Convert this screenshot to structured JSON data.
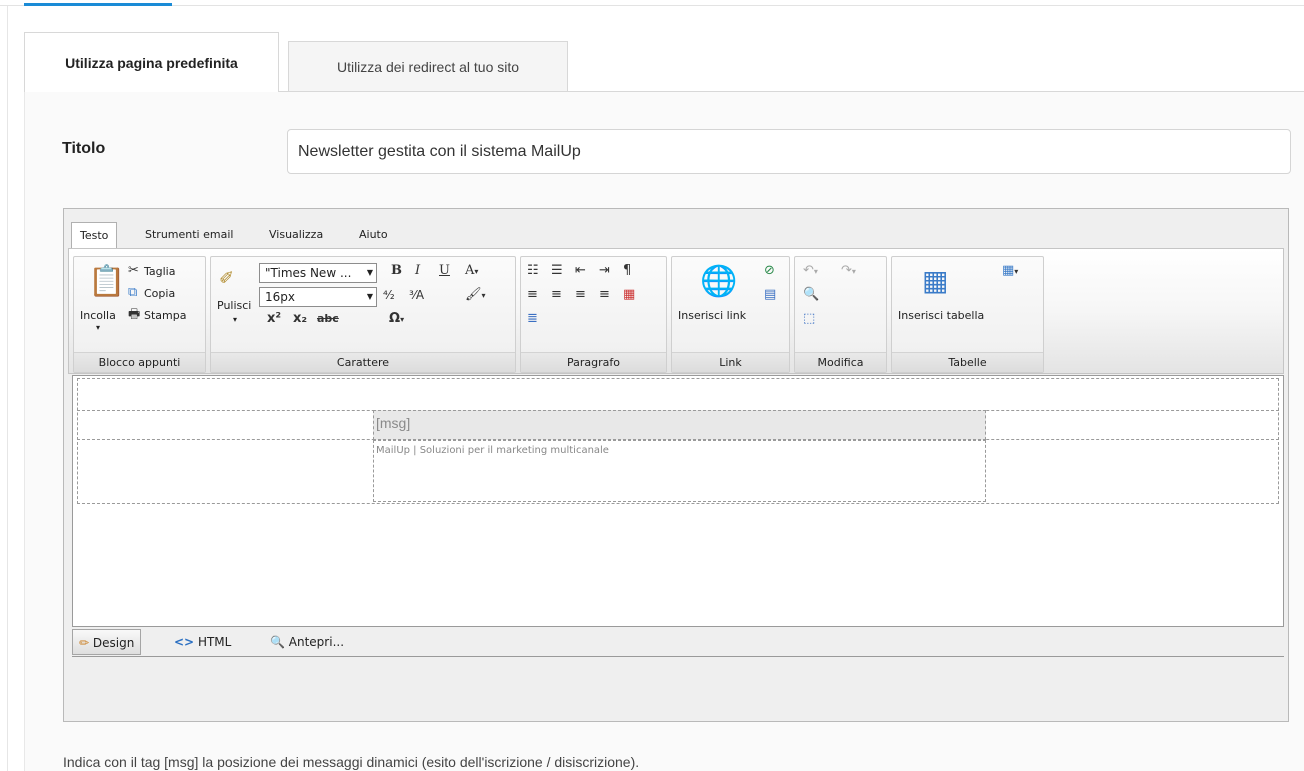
{
  "tabs": {
    "default_page": "Utilizza pagina predefinita",
    "redirect": "Utilizza dei redirect al tuo sito"
  },
  "form": {
    "title_label": "Titolo",
    "title_value": "Newsletter gestita con il sistema MailUp"
  },
  "editor": {
    "ribbon_tabs": [
      "Testo",
      "Strumenti email",
      "Visualizza",
      "Aiuto"
    ],
    "groups": {
      "clipboard": {
        "label": "Blocco appunti",
        "paste": "Incolla",
        "cut": "Taglia",
        "copy": "Copia",
        "print": "Stampa"
      },
      "font": {
        "label": "Carattere",
        "clean": "Pulisci",
        "font_name": "\"Times New ...",
        "font_size": "16px"
      },
      "paragraph": {
        "label": "Paragrafo"
      },
      "link": {
        "label": "Link",
        "insert_link": "Inserisci link"
      },
      "edit": {
        "label": "Modifica"
      },
      "tables": {
        "label": "Tabelle",
        "insert_table": "Inserisci tabella"
      }
    },
    "content": {
      "msg_tag": "[msg]",
      "footer_text": "MailUp | Soluzioni per il marketing multicanale"
    },
    "modes": {
      "design": "Design",
      "html": "HTML",
      "preview": "Antepri..."
    }
  },
  "hint": "Indica con il tag [msg] la posizione dei messaggi dinamici (esito dell'iscrizione / disiscrizione).",
  "colors": {
    "accent": "#1a8bd6"
  }
}
